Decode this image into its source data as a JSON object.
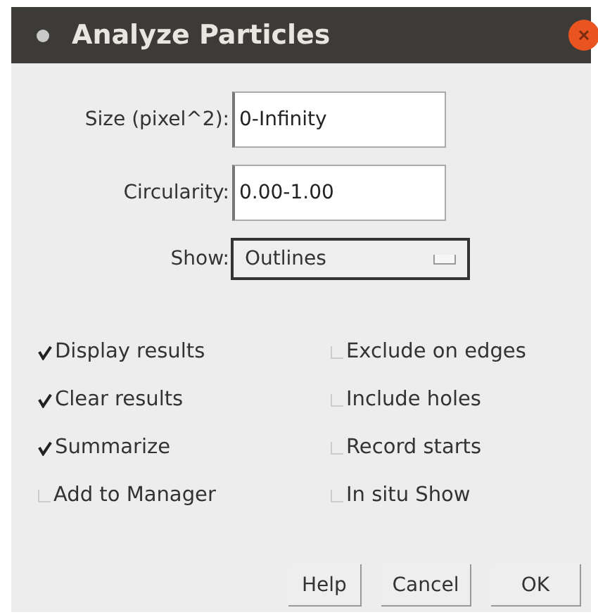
{
  "window": {
    "title": "Analyze Particles"
  },
  "fields": [
    {
      "label": "Size (pixel^2):",
      "value": "0-Infinity"
    },
    {
      "label": "Circularity:",
      "value": "0.00-1.00"
    }
  ],
  "show": {
    "label": "Show:",
    "value": "Outlines"
  },
  "checkboxes": [
    [
      {
        "label": "Display results",
        "checked": true
      },
      {
        "label": "Clear results",
        "checked": true
      },
      {
        "label": "Summarize",
        "checked": true
      },
      {
        "label": "Add to Manager",
        "checked": false
      }
    ],
    [
      {
        "label": "Exclude on edges",
        "checked": false
      },
      {
        "label": "Include holes",
        "checked": false
      },
      {
        "label": "Record starts",
        "checked": false
      },
      {
        "label": "In situ Show",
        "checked": false
      }
    ]
  ],
  "buttons": [
    "Help",
    "Cancel",
    "OK"
  ]
}
